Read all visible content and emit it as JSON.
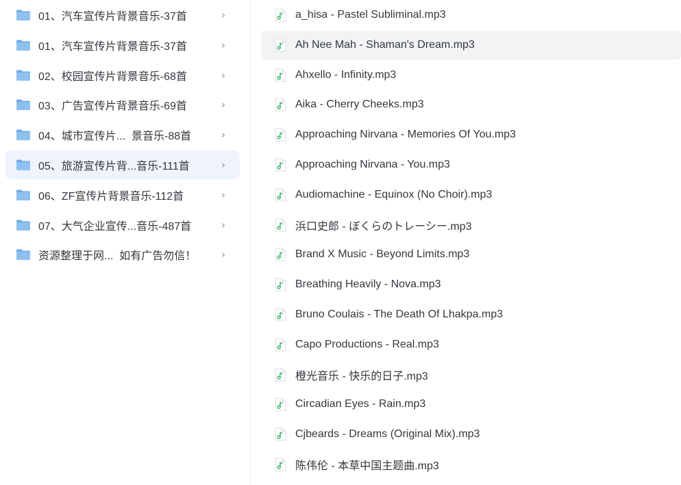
{
  "folders": [
    {
      "label": "01、汽车宣传片背景音乐-37首",
      "icon": "folder-icon",
      "chevron": "›"
    },
    {
      "label": "01、汽车宣传片背景音乐-37首",
      "icon": "folder-icon",
      "chevron": "›"
    },
    {
      "label": "02、校园宣传片背景音乐-68首",
      "icon": "folder-icon",
      "chevron": "›"
    },
    {
      "label": "03、广告宣传片背景音乐-69首",
      "icon": "folder-icon",
      "chevron": "›"
    },
    {
      "label": "04、城市宣传片...  景音乐-88首",
      "icon": "folder-icon",
      "chevron": "›"
    },
    {
      "label": "05、旅游宣传片背...音乐-111首",
      "icon": "folder-icon",
      "chevron": "›",
      "selected": true
    },
    {
      "label": "06、ZF宣传片背景音乐-112首",
      "icon": "folder-icon",
      "chevron": "›"
    },
    {
      "label": "07、大气企业宣传...音乐-487首",
      "icon": "folder-icon",
      "chevron": "›"
    },
    {
      "label": "资源整理于网...  如有广告勿信！",
      "icon": "folder-icon",
      "chevron": "›"
    }
  ],
  "files": [
    {
      "label": "a_hisa - Pastel Subliminal.mp3",
      "icon": "audio-file-icon"
    },
    {
      "label": "Ah Nee Mah - Shaman's Dream.mp3",
      "icon": "audio-file-icon",
      "hover": true
    },
    {
      "label": "Ahxello - Infinity.mp3",
      "icon": "audio-file-icon"
    },
    {
      "label": "Aika - Cherry Cheeks.mp3",
      "icon": "audio-file-icon"
    },
    {
      "label": "Approaching Nirvana - Memories Of You.mp3",
      "icon": "audio-file-icon"
    },
    {
      "label": "Approaching Nirvana - You.mp3",
      "icon": "audio-file-icon"
    },
    {
      "label": "Audiomachine - Equinox (No Choir).mp3",
      "icon": "audio-file-icon"
    },
    {
      "label": "浜口史郎 - ぼくらのトレーシー.mp3",
      "icon": "audio-file-icon"
    },
    {
      "label": "Brand X Music - Beyond Limits.mp3",
      "icon": "audio-file-icon"
    },
    {
      "label": "Breathing Heavily - Nova.mp3",
      "icon": "audio-file-icon"
    },
    {
      "label": "Bruno Coulais - The Death Of Lhakpa.mp3",
      "icon": "audio-file-icon"
    },
    {
      "label": "Capo Productions - Real.mp3",
      "icon": "audio-file-icon"
    },
    {
      "label": "橙光音乐 - 快乐的日子.mp3",
      "icon": "audio-file-icon"
    },
    {
      "label": "Circadian Eyes - Rain.mp3",
      "icon": "audio-file-icon"
    },
    {
      "label": "Cjbeards - Dreams (Original Mix).mp3",
      "icon": "audio-file-icon"
    },
    {
      "label": "陈伟伦 - 本草中国主题曲.mp3",
      "icon": "audio-file-icon"
    }
  ],
  "colors": {
    "folder_body": "#8ec1f0",
    "folder_tab": "#6fa9e6",
    "audio_accent": "#39b36a",
    "selected_bg": "#eef3fe",
    "hover_bg": "#f2f3f5"
  }
}
